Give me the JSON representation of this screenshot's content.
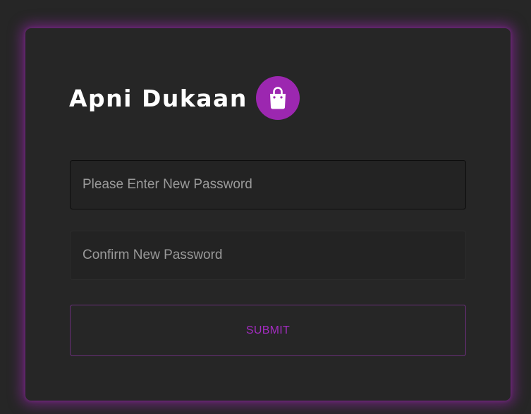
{
  "brand": {
    "title": "Apni Dukaan",
    "icon": "shopping-bag-icon",
    "accent_color": "#9c27b0"
  },
  "form": {
    "new_password_placeholder": "Please Enter New Password",
    "new_password_value": "",
    "confirm_password_placeholder": "Confirm New Password",
    "confirm_password_value": "",
    "submit_label": "SUBMIT"
  },
  "colors": {
    "background": "#262626",
    "submit_text": "#a32cc0"
  }
}
